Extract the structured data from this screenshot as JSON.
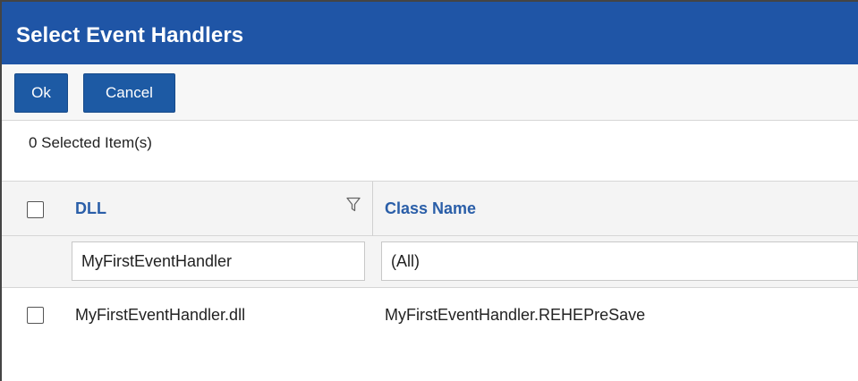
{
  "dialog": {
    "title": "Select Event Handlers"
  },
  "toolbar": {
    "ok_label": "Ok",
    "cancel_label": "Cancel"
  },
  "selection": {
    "count_text": "0  Selected Item(s)"
  },
  "grid": {
    "columns": [
      {
        "label": "DLL",
        "filterable": true
      },
      {
        "label": "Class Name",
        "filterable": false
      }
    ],
    "filters": {
      "dll": "MyFirstEventHandler",
      "class_name": "(All)"
    },
    "rows": [
      {
        "dll": "MyFirstEventHandler.dll",
        "class_name": "MyFirstEventHandler.REHEPreSave",
        "checked": false
      }
    ]
  },
  "colors": {
    "title_bar": "#1f55a6",
    "button": "#1d5aa4",
    "column_header_text": "#2a5ea8"
  },
  "icons": {
    "filter": "filter-funnel-icon"
  }
}
